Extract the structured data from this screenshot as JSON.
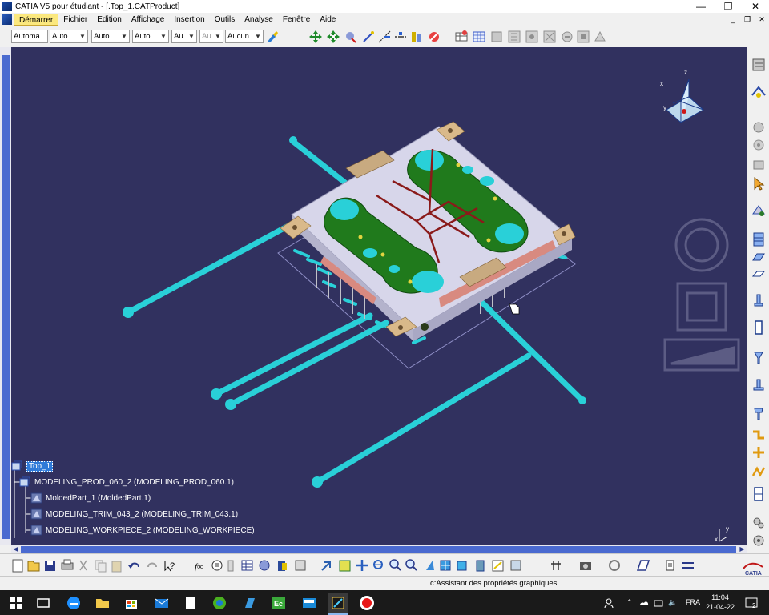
{
  "window": {
    "title": "CATIA V5 pour étudiant - [.Top_1.CATProduct]",
    "controls": [
      "—",
      "❐",
      "✕"
    ]
  },
  "menu": {
    "items": [
      "Démarrer",
      "Fichier",
      "Edition",
      "Affichage",
      "Insertion",
      "Outils",
      "Analyse",
      "Fenêtre",
      "Aide"
    ],
    "active_index": 0,
    "mdi_controls": [
      "_",
      "❐",
      "✕"
    ]
  },
  "properties_toolbar": {
    "combos": [
      "Automa",
      "Auto",
      "Auto",
      "Auto",
      "Au",
      "Au",
      "Aucun"
    ],
    "disabled_index": 5
  },
  "tree": {
    "root": "Top_1",
    "children": [
      "MODELING_PROD_060_2 (MODELING_PROD_060.1)",
      "MoldedPart_1 (MoldedPart.1)",
      "MODELING_TRIM_043_2 (MODELING_TRIM_043.1)",
      "MODELING_WORKPIECE_2 (MODELING_WORKPIECE)"
    ]
  },
  "compass": {
    "x_label": "x",
    "y_label": "y",
    "z_label": "z"
  },
  "axis_mini": {
    "x_label": "x",
    "y_label": "y"
  },
  "status": {
    "message": "c:Assistant des propriétés graphiques"
  },
  "taskbar": {
    "lang": "FRA",
    "time": "11:04",
    "date": "21-04-22",
    "notifications": "2"
  },
  "colors": {
    "viewport_bg": "#31315f",
    "plate": "#d7d6ea",
    "mold_green": "#207a1c",
    "cyan_pins": "#29d0d8",
    "tan_blocks": "#d9b98a",
    "runner_red": "#8a1a1a"
  },
  "icons": {
    "toolbar_top": [
      "paintbrush-icon",
      "pan-icon",
      "rotate-icon",
      "fly-icon",
      "magnet-icon",
      "normal-view-icon",
      "snap-icon",
      "analysis-icon",
      "catalog-icon",
      "table-icon",
      "grid-icon",
      "constraint-icon",
      "dimensions-icon",
      "settings-icon"
    ],
    "toolbar_bottom": [
      "new-icon",
      "open-icon",
      "save-icon",
      "print-icon",
      "cut-icon",
      "copy-icon",
      "paste-icon",
      "undo-icon",
      "redo-icon",
      "whats-this-icon",
      "formula-icon",
      "knowledge-icon",
      "measure-icon",
      "table-icon",
      "component-icon",
      "catalog-icon",
      "snap-icon",
      "fit-all-icon",
      "pan-icon",
      "rotate-icon",
      "zoom-in-icon",
      "zoom-out-icon",
      "normal-view-icon",
      "iso-view-icon",
      "shading-icon",
      "hide-show-icon",
      "swap-icon",
      "perspective-icon",
      "render-icon",
      "capture-icon",
      "refresh-icon",
      "macro-icon",
      "paths-icon",
      "catia-logo"
    ]
  }
}
